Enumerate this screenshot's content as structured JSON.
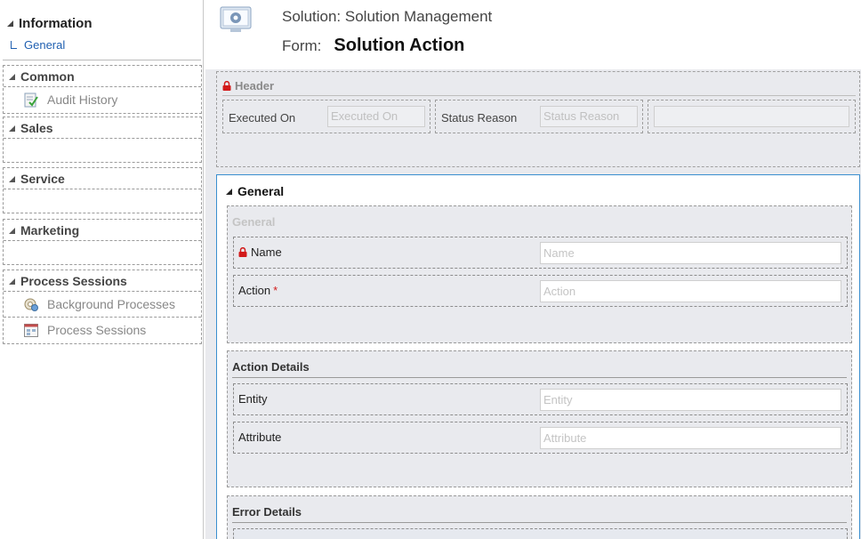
{
  "nav": {
    "information": {
      "title": "Information",
      "items": [
        "General"
      ]
    },
    "groups": [
      {
        "title": "Common",
        "items": [
          {
            "label": "Audit History",
            "icon": "audit-history-icon"
          }
        ]
      },
      {
        "title": "Sales",
        "items": []
      },
      {
        "title": "Service",
        "items": []
      },
      {
        "title": "Marketing",
        "items": []
      },
      {
        "title": "Process Sessions",
        "items": [
          {
            "label": "Background Processes",
            "icon": "background-processes-icon"
          },
          {
            "label": "Process Sessions",
            "icon": "process-sessions-icon"
          }
        ]
      }
    ]
  },
  "header": {
    "solution_line": "Solution: Solution Management",
    "form_label": "Form:",
    "form_name": "Solution Action",
    "icon": "solution-gear-icon"
  },
  "header_section": {
    "title": "Header",
    "fields": [
      {
        "label": "Executed On",
        "placeholder": "Executed On"
      },
      {
        "label": "Status Reason",
        "placeholder": "Status Reason"
      }
    ]
  },
  "tab": {
    "title": "General",
    "sections": [
      {
        "title": "General",
        "fields": [
          {
            "label": "Name",
            "placeholder": "Name",
            "locked": true,
            "required": false
          },
          {
            "label": "Action",
            "placeholder": "Action",
            "locked": false,
            "required": true,
            "required_mark": "*"
          }
        ]
      },
      {
        "title": "Action Details",
        "fields": [
          {
            "label": "Entity",
            "placeholder": "Entity"
          },
          {
            "label": "Attribute",
            "placeholder": "Attribute"
          }
        ]
      },
      {
        "title": "Error Details",
        "fields": []
      }
    ]
  },
  "colors": {
    "accent_blue": "#1f5fb0",
    "tab_border": "#3a8fcf",
    "lock_red": "#d21a1a",
    "canvas_grey": "#e9eaee"
  }
}
